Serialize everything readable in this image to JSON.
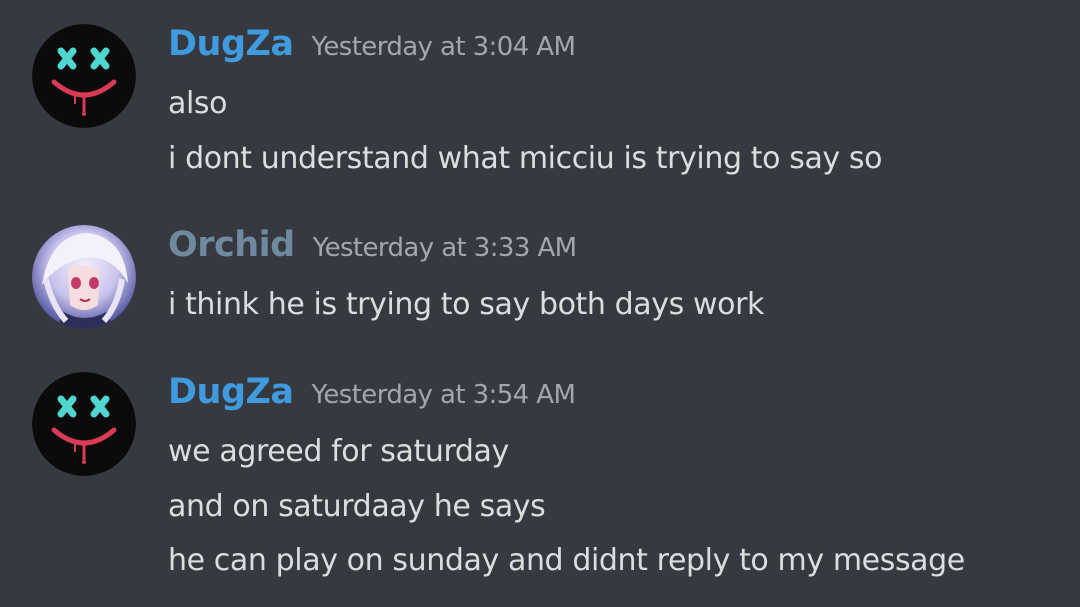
{
  "colors": {
    "background": "#36393f",
    "dugza_name": "#3f9ade",
    "orchid_name": "#6f8a9e",
    "timestamp": "#a3a6aa",
    "message_text": "#dcddde"
  },
  "messages": [
    {
      "username": "DugZa",
      "timestamp": "Yesterday at 3:04 AM",
      "avatar_icon": "mask-x-eyes-icon",
      "lines": [
        "also",
        "i dont understand what micciu is trying to say so"
      ]
    },
    {
      "username": "Orchid",
      "timestamp": "Yesterday at 3:33 AM",
      "avatar_icon": "anime-girl-avatar",
      "lines": [
        "i think he is trying to say both days work"
      ]
    },
    {
      "username": "DugZa",
      "timestamp": "Yesterday at 3:54 AM",
      "avatar_icon": "mask-x-eyes-icon",
      "lines": [
        "we agreed for saturday",
        "and on saturdaay he says",
        "he can play on sunday and didnt reply to my message"
      ]
    }
  ]
}
